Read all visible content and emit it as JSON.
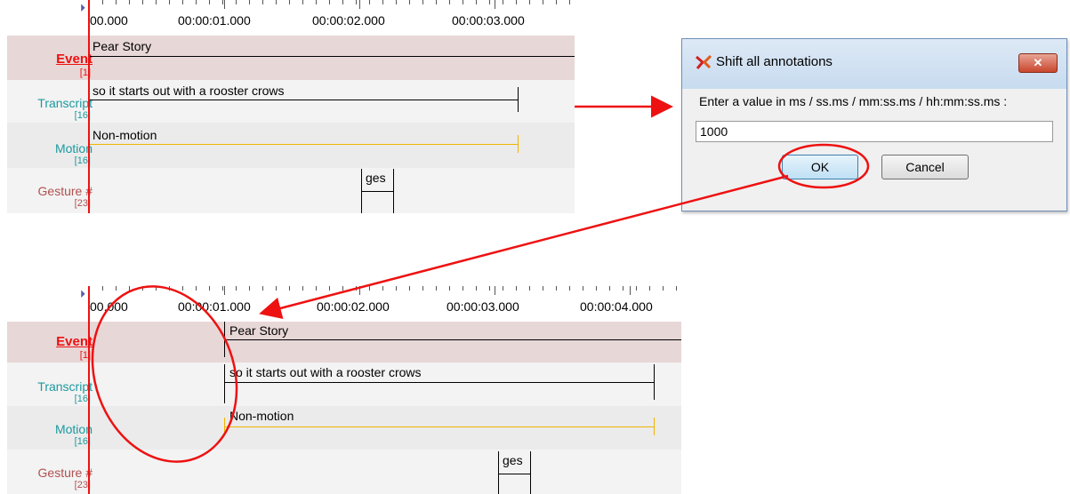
{
  "colors": {
    "event": "#ee1111",
    "transcript": "#1b9aa0",
    "motion": "#1b9aa0",
    "gesture": "#b05050",
    "motion_line": "#f0b400",
    "event_bg": "#e8d7d7",
    "row_gray": "#ebebeb"
  },
  "top_timeline": {
    "ruler_labels": [
      "00.000",
      "00:00:01.000",
      "00:00:02.000",
      "00:00:03.000"
    ],
    "tiers": [
      {
        "name": "Event",
        "count": "[1]"
      },
      {
        "name": "Transcript",
        "count": "[16]"
      },
      {
        "name": "Motion",
        "count": "[16]"
      },
      {
        "name": "Gesture #",
        "count": "[23]"
      }
    ],
    "annotations": {
      "event": "Pear Story",
      "transcript": "so it starts out with a rooster crows",
      "motion": "Non-motion",
      "gesture": "ges"
    }
  },
  "bottom_timeline": {
    "ruler_labels": [
      "00.000",
      "00:00:01.000",
      "00:00:02.000",
      "00:00:03.000",
      "00:00:04.000"
    ],
    "tiers": [
      {
        "name": "Event",
        "count": "[1]"
      },
      {
        "name": "Transcript",
        "count": "[16]"
      },
      {
        "name": "Motion",
        "count": "[16]"
      },
      {
        "name": "Gesture #",
        "count": "[23]"
      }
    ],
    "annotations": {
      "event": "Pear Story",
      "transcript": "so it starts out with a rooster crows",
      "motion": "Non-motion",
      "gesture": "ges"
    }
  },
  "dialog": {
    "title": "Shift all annotations",
    "close_label": "✕",
    "prompt": "Enter a value in ms / ss.ms / mm:ss.ms / hh:mm:ss.ms :",
    "value": "1000",
    "ok_label": "OK",
    "cancel_label": "Cancel"
  }
}
